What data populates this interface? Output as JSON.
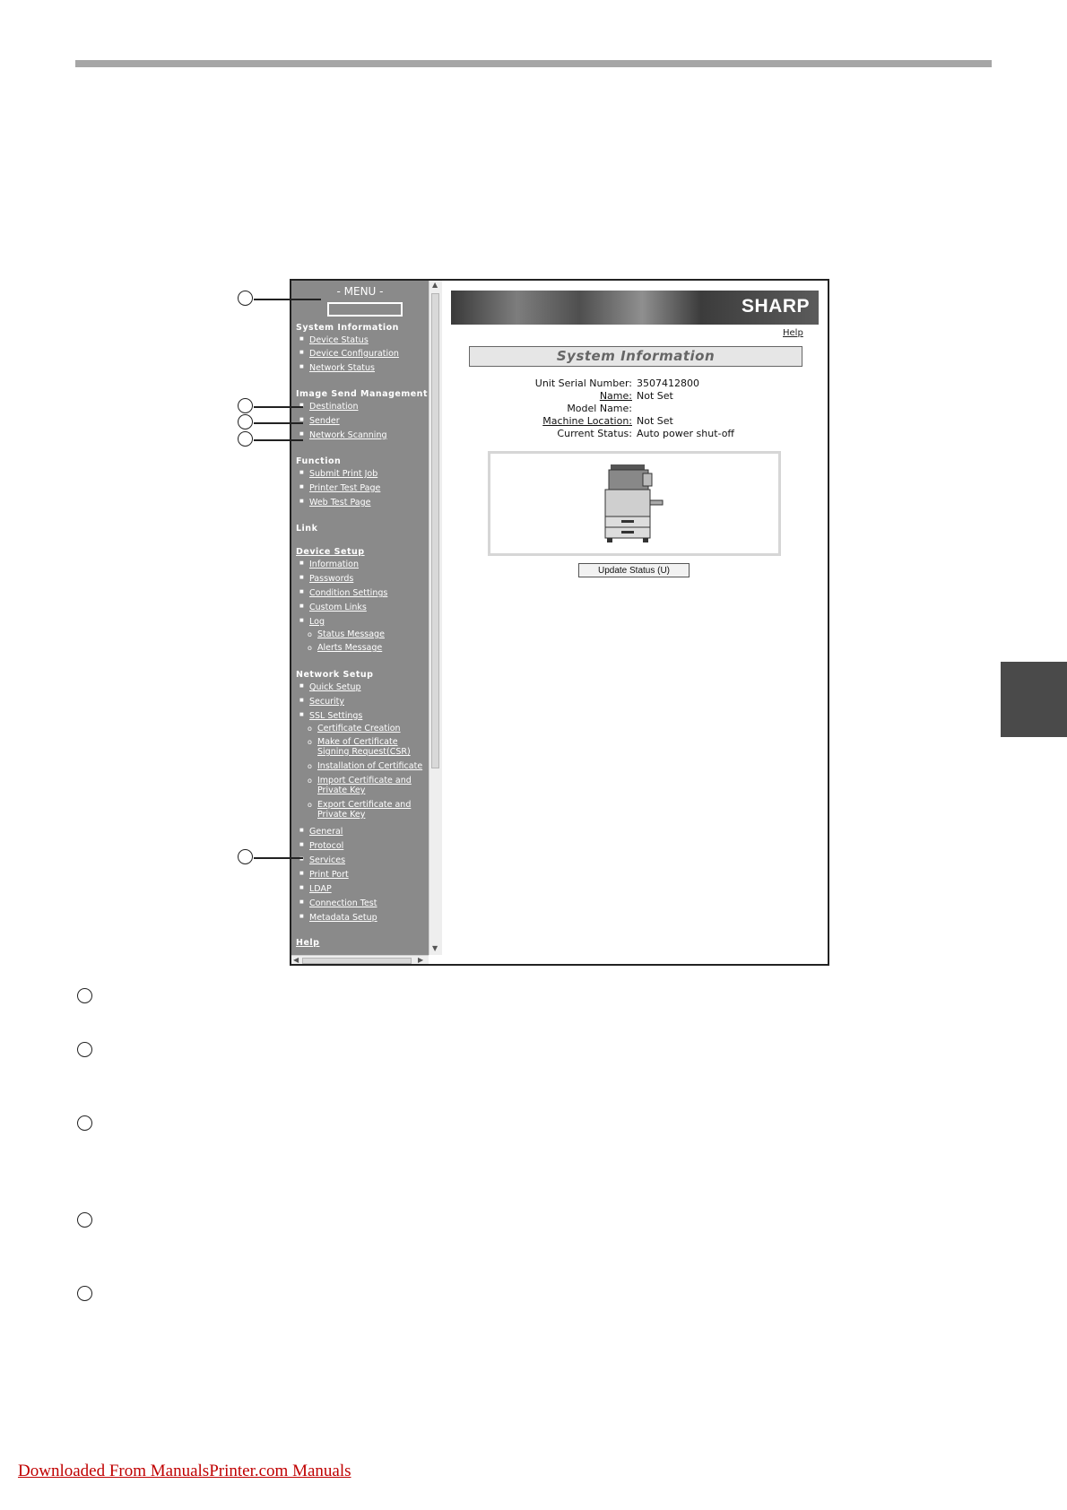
{
  "menu": {
    "title": "- MENU -",
    "system_information": {
      "heading": "System Information",
      "items": [
        "Device Status",
        "Device Configuration",
        "Network Status"
      ]
    },
    "image_send_management": {
      "heading": "Image Send Management",
      "items": [
        "Destination",
        "Sender",
        "Network Scanning"
      ]
    },
    "function": {
      "heading": "Function",
      "items": [
        "Submit Print Job",
        "Printer Test Page",
        "Web Test Page"
      ]
    },
    "link": {
      "heading": "Link"
    },
    "device_setup": {
      "heading": "Device Setup",
      "items": [
        "Information",
        "Passwords",
        "Condition Settings",
        "Custom Links",
        "Log"
      ],
      "log_subitems": [
        "Status Message",
        "Alerts Message"
      ]
    },
    "network_setup": {
      "heading": "Network Setup",
      "items": [
        "Quick Setup",
        "Security",
        "SSL Settings"
      ],
      "ssl_subitems": [
        "Certificate Creation",
        "Make of Certificate Signing Request(CSR)",
        "Installation of Certificate",
        "Import Certificate and Private Key",
        "Export Certificate and Private Key"
      ],
      "more_items": [
        "General",
        "Protocol",
        "Services",
        "Print Port",
        "LDAP",
        "Connection Test",
        "Metadata Setup"
      ]
    },
    "help": "Help"
  },
  "page": {
    "brand": "SHARP",
    "help_link": "Help",
    "title": "System Information",
    "fields": [
      {
        "label": "Unit Serial Number:",
        "value": "3507412800"
      },
      {
        "label": "Name:",
        "value": "Not Set"
      },
      {
        "label": "Model Name:",
        "value": ""
      },
      {
        "label": "Machine Location:",
        "value": "Not Set"
      },
      {
        "label": "Current Status:",
        "value": "Auto power shut-off"
      }
    ],
    "update_button": "Update Status (U)"
  },
  "footer": {
    "link": "Downloaded From ManualsPrinter.com Manuals"
  }
}
